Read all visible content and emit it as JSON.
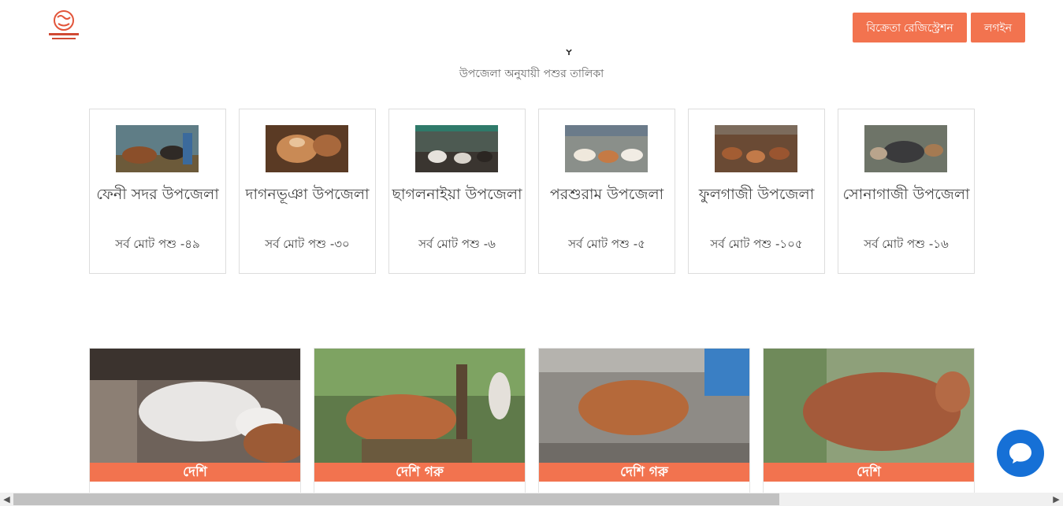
{
  "header": {
    "logo_alt": "পশুর হাট",
    "register_label": "বিক্রেতা রেজিস্ট্রেশন",
    "login_label": "লগইন"
  },
  "section": {
    "subtitle": "উপজেলা অনুযায়ী পশুর তালিকা"
  },
  "upazilas": [
    {
      "name": "ফেনী সদর উপজেলা",
      "count": "সর্ব মোট পশু -৪৯"
    },
    {
      "name": "দাগনভূঞা উপজেলা",
      "count": "সর্ব মোট পশু -৩০"
    },
    {
      "name": "ছাগলনাইয়া উপজেলা",
      "count": "সর্ব মোট পশু -৬"
    },
    {
      "name": "পরশুরাম উপজেলা",
      "count": "সর্ব মোট পশু -৫"
    },
    {
      "name": "ফুলগাজী উপজেলা",
      "count": "সর্ব মোট পশু -১০৫"
    },
    {
      "name": "সোনাগাজী উপজেলা",
      "count": "সর্ব মোট পশু -১৬"
    }
  ],
  "animals": [
    {
      "label": "দেশি"
    },
    {
      "label": "দেশি গরু"
    },
    {
      "label": "দেশি গরু"
    },
    {
      "label": "দেশি"
    }
  ],
  "colors": {
    "accent": "#f2734f",
    "chat": "#1670d6"
  }
}
